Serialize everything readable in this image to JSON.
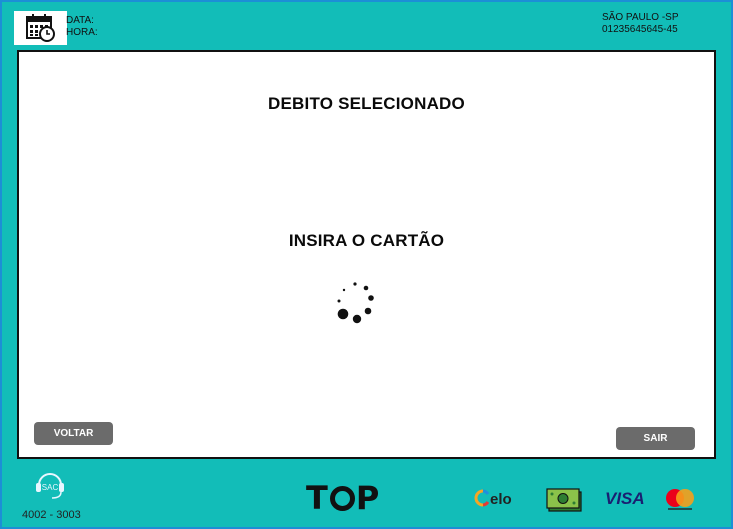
{
  "header": {
    "date_label": "DATA:",
    "time_label": "HORA:",
    "location": "SÃO PAULO -SP",
    "terminal_id": "01235645645-45",
    "calendar_icon": "calendar-clock-icon"
  },
  "main": {
    "title": "DEBITO SELECIONADO",
    "message": "INSIRA O CARTÃO",
    "spinner_icon": "loading-spinner-icon"
  },
  "buttons": {
    "back_label": "VOLTAR",
    "exit_label": "SAIR"
  },
  "footer": {
    "sac_label": "SAC",
    "sac_phone": "4002 - 3003",
    "brand": "TOP",
    "payment_methods": [
      "elo",
      "cash",
      "VISA",
      "mastercard"
    ]
  },
  "colors": {
    "background": "#12bdb8",
    "panel": "#ffffff",
    "button": "#6b6b6b",
    "text": "#0a0a0a"
  }
}
